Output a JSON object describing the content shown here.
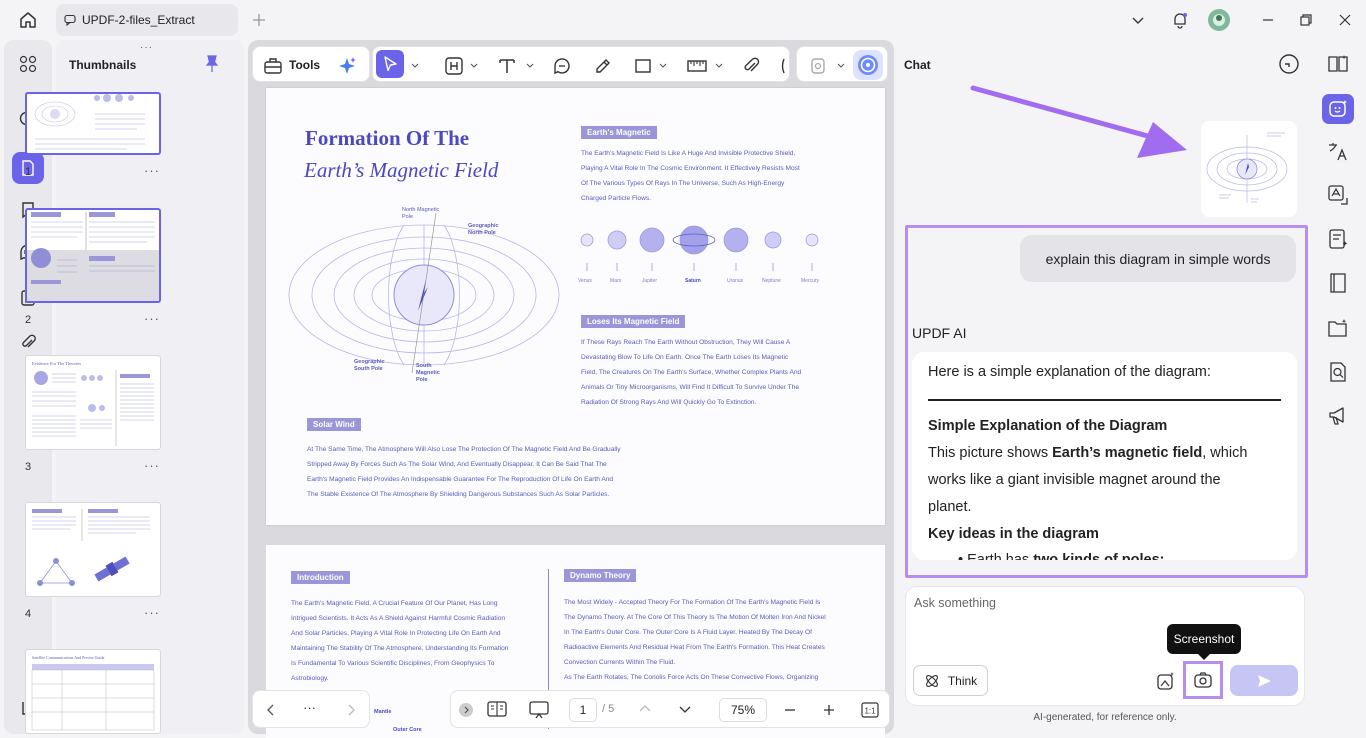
{
  "titlebar": {
    "tab_title": "UPDF-2-files_Extract"
  },
  "thumbnails": {
    "title": "Thumbnails",
    "pages": [
      "1",
      "2",
      "3",
      "4"
    ]
  },
  "toolbar": {
    "tools_label": "Tools"
  },
  "page1": {
    "title_line1": "Formation Of The",
    "title_line2": "Earth’s Magnetic Field",
    "label_north_magnetic": "North Magnetic Pole",
    "label_geo_north": "Geographic North Pole",
    "label_geo_south": "Geographic South Pole",
    "label_south_magnetic": "South Magnetic Pole",
    "section1_heading": "Earth's Magnetic",
    "section1_lines": [
      "The Earth's Magnetic Field Is Like A Huge And Invisible Protective Shield,",
      "Playing A Vital Role In The Cosmic Environment. It Effectively Resists Most",
      "Of The Various Types Of Rays In The Universe, Such As High-Energy",
      "Charged Particle Flows."
    ],
    "planets": [
      "Venus",
      "Mars",
      "Jupiter",
      "Saturn",
      "Uranus",
      "Neptune",
      "Mercury"
    ],
    "section2_heading": "Loses Its Magnetic Field",
    "section2_lines": [
      "If These Rays Reach The Earth Without Obstruction, They Will Cause A",
      "Devastating Blow To Life On Earth. Once The Earth Loses Its Magnetic",
      "Field, The Creatures On The Earth's Surface, Whether Complex Plants And",
      "Animals Or Tiny Microorganisms, Will Find It Difficult To Survive Under The",
      "Radiation Of Strong Rays And Will Quickly Go To Extinction."
    ],
    "section3_heading": "Solar Wind",
    "section3_lines": [
      "At The Same Time, The Atmosphere Will Also Lose The Protection Of The Magnetic Field And Be Gradually",
      "Stripped Away By Forces Such As The Solar Wind, And Eventually Disappear. It Can Be Said That The",
      "Earth's Magnetic Field Provides An Indispensable Guarantee For The Reproduction Of Life On Earth And",
      "The Stable Existence Of The Atmosphere By Shielding Dangerous Substances Such As Solar Particles."
    ]
  },
  "page2": {
    "intro_heading": "Introduction",
    "intro_lines": [
      "The Earth's Magnetic Field, A Crucial Feature Of Our Planet, Has Long",
      "Intrigued Scientists. It Acts As A Shield Against Harmful Cosmic Radiation",
      "And Solar Particles, Playing A Vital Role In Protecting Life On Earth And",
      "Maintaining The Stability Of The Atmosphere. Understanding Its Formation",
      "Is Fundamental To Various Scientific Disciplines, From Geophysics To",
      "Astrobiology."
    ],
    "dynamo_heading": "Dynamo Theory",
    "dynamo_lines": [
      "The Most Widely - Accepted Theory For The Formation Of The Earth's Magnetic Field Is",
      "The Dynamo Theory. At The Core Of This Theory Is The Motion Of Molten Iron And Nickel",
      "In The Earth's Outer Core. The Outer Core Is A Fluid Layer, Heated By The Decay Of",
      "Radioactive Elements And Residual Heat From The Earth's Formation. This Heat Creates",
      "Convection Currents Within The Fluid.",
      "As The Earth Rotates, The Coriolis Force Acts On These Convective Flows, Organizing"
    ],
    "mantle_label": "Mantle",
    "outer_core_label": "Outer Core"
  },
  "bottombar": {
    "page_current": "1",
    "page_total": "/ 5",
    "zoom": "75%",
    "more": "···"
  },
  "chat": {
    "title": "Chat",
    "user_message": "explain this diagram in simple words",
    "ai_name": "UPDF AI",
    "ai_intro": "Here is a simple explanation of the diagram:",
    "ai_heading": "Simple Explanation of the Diagram",
    "ai_p1_a": "This picture shows ",
    "ai_p1_b": "Earth’s magnetic field",
    "ai_p1_c": ", which",
    "ai_p2": "works like a giant invisible magnet around the",
    "ai_p3": "planet.",
    "ai_heading2": "Key ideas in the diagram",
    "ai_bullet_a": "Earth has ",
    "ai_bullet_b": "two kinds of poles:",
    "ask_placeholder": "Ask something",
    "think_label": "Think",
    "screenshot_tooltip": "Screenshot",
    "disclaimer": "AI-generated, for reference only."
  },
  "colors": {
    "accent": "#6b63e8",
    "highlight_border": "#b48ff0",
    "doc_text": "#5b5bb8"
  }
}
